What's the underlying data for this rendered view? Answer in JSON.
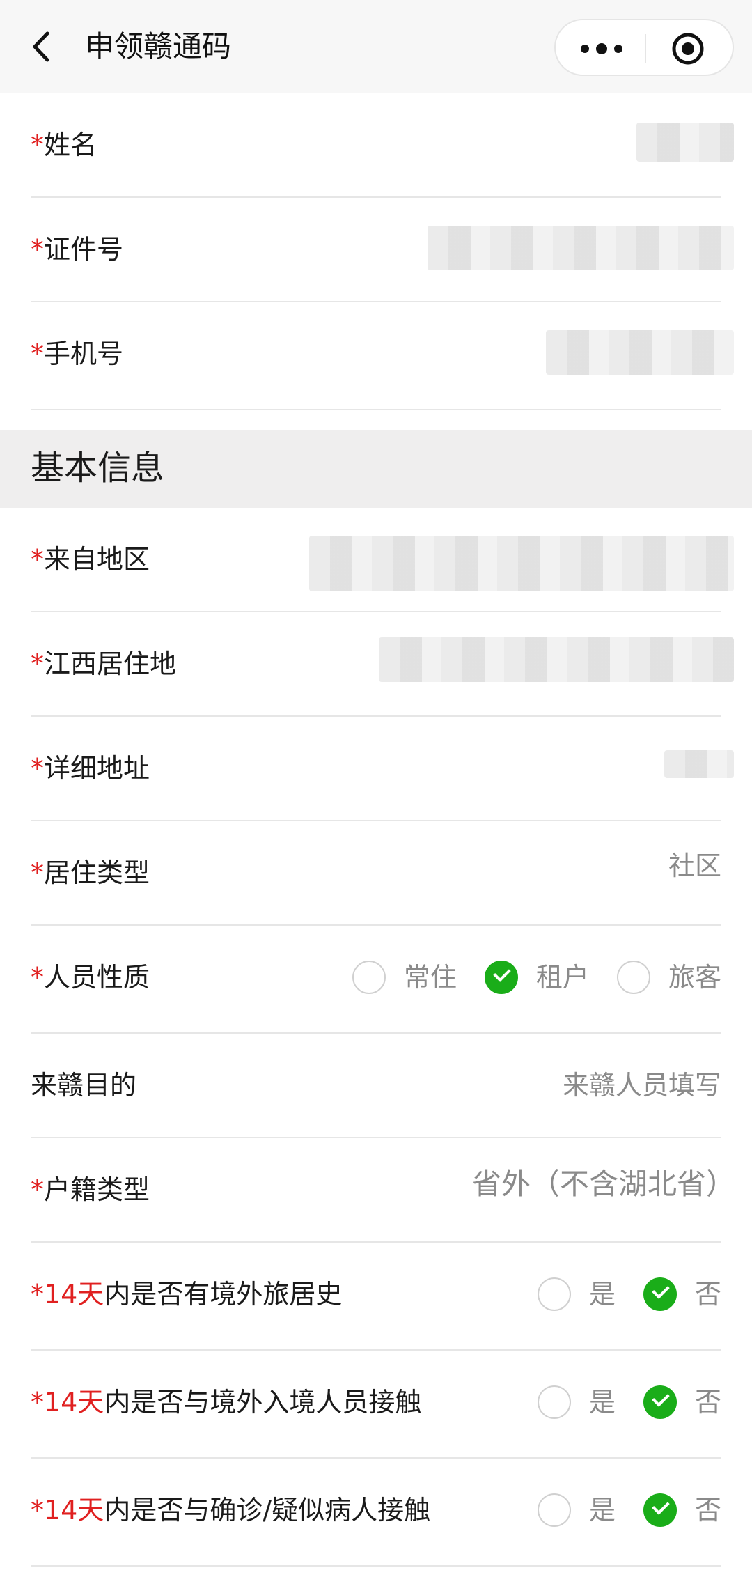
{
  "header": {
    "title": "申领赣通码"
  },
  "fields": {
    "name": {
      "required": "*",
      "label": "姓名"
    },
    "id_number": {
      "required": "*",
      "label": "证件号"
    },
    "phone": {
      "required": "*",
      "label": "手机号"
    }
  },
  "section": {
    "title": "基本信息"
  },
  "basic": {
    "from_region": {
      "required": "*",
      "label": "来自地区"
    },
    "jx_residence": {
      "required": "*",
      "label": "江西居住地"
    },
    "address": {
      "required": "*",
      "label": "详细地址"
    },
    "residence_type": {
      "required": "*",
      "label": "居住类型",
      "value": "社区"
    },
    "person_type": {
      "required": "*",
      "label": "人员性质",
      "options": [
        {
          "label": "常住",
          "selected": false
        },
        {
          "label": "租户",
          "selected": true
        },
        {
          "label": "旅客",
          "selected": false
        }
      ]
    },
    "purpose": {
      "label": "来赣目的",
      "value": "来赣人员填写"
    },
    "household_type": {
      "required": "*",
      "label": "户籍类型",
      "value": "省外（不含湖北省）"
    },
    "q1": {
      "required": "*",
      "prefix": "14天",
      "label": "内是否有境外旅居史",
      "yes": "是",
      "no": "否",
      "selected": "no"
    },
    "q2": {
      "required": "*",
      "prefix": "14天",
      "label": "内是否与境外入境人员接触",
      "yes": "是",
      "no": "否",
      "selected": "no"
    },
    "q3": {
      "required": "*",
      "prefix": "14天",
      "label": "内是否与确诊/疑似病人接触",
      "yes": "是",
      "no": "否",
      "selected": "no"
    }
  },
  "colors": {
    "required": "#e02020",
    "accent": "#1aad19",
    "section_bg": "#efeeee"
  }
}
